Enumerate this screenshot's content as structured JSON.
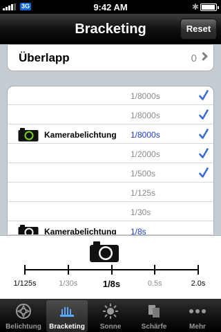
{
  "status": {
    "carrier_badge": "3G",
    "time": "9:42 AM"
  },
  "nav": {
    "title": "Bracketing",
    "reset_label": "Reset"
  },
  "overlap": {
    "label": "Überlapp",
    "value": "0"
  },
  "rows": [
    {
      "label": "",
      "speed": "1/8000s",
      "checked": true,
      "camera": false,
      "current": false
    },
    {
      "label": "",
      "speed": "1/8000s",
      "checked": true,
      "camera": false,
      "current": false
    },
    {
      "label": "Kamerabelichtung",
      "speed": "1/8000s",
      "checked": true,
      "camera": true,
      "camera_color": "green",
      "current": true
    },
    {
      "label": "",
      "speed": "1/2000s",
      "checked": true,
      "camera": false,
      "current": false
    },
    {
      "label": "",
      "speed": "1/500s",
      "checked": true,
      "camera": false,
      "current": false
    },
    {
      "label": "",
      "speed": "1/125s",
      "checked": false,
      "camera": false,
      "current": false
    },
    {
      "label": "",
      "speed": "1/30s",
      "checked": false,
      "camera": false,
      "current": false
    },
    {
      "label": "Kamerabelichtung",
      "speed": "1/8s",
      "checked": false,
      "camera": true,
      "camera_color": "black",
      "current": true
    }
  ],
  "scale": {
    "labels": [
      "1/125s",
      "1/30s",
      "1/8s",
      "0.5s",
      "2.0s"
    ],
    "selected_index": 2
  },
  "tabs": [
    {
      "label": "Belichtung",
      "icon": "aperture-icon",
      "active": false
    },
    {
      "label": "Bracketing",
      "icon": "bracketing-icon",
      "active": true
    },
    {
      "label": "Sonne",
      "icon": "sun-icon",
      "active": false
    },
    {
      "label": "Schärfe",
      "icon": "focus-icon",
      "active": false
    },
    {
      "label": "Mehr",
      "icon": "more-icon",
      "active": false
    }
  ],
  "colors": {
    "check": "#3a6bd0",
    "current_speed": "#1c3bd2",
    "camera_green": "#7ad12a"
  }
}
